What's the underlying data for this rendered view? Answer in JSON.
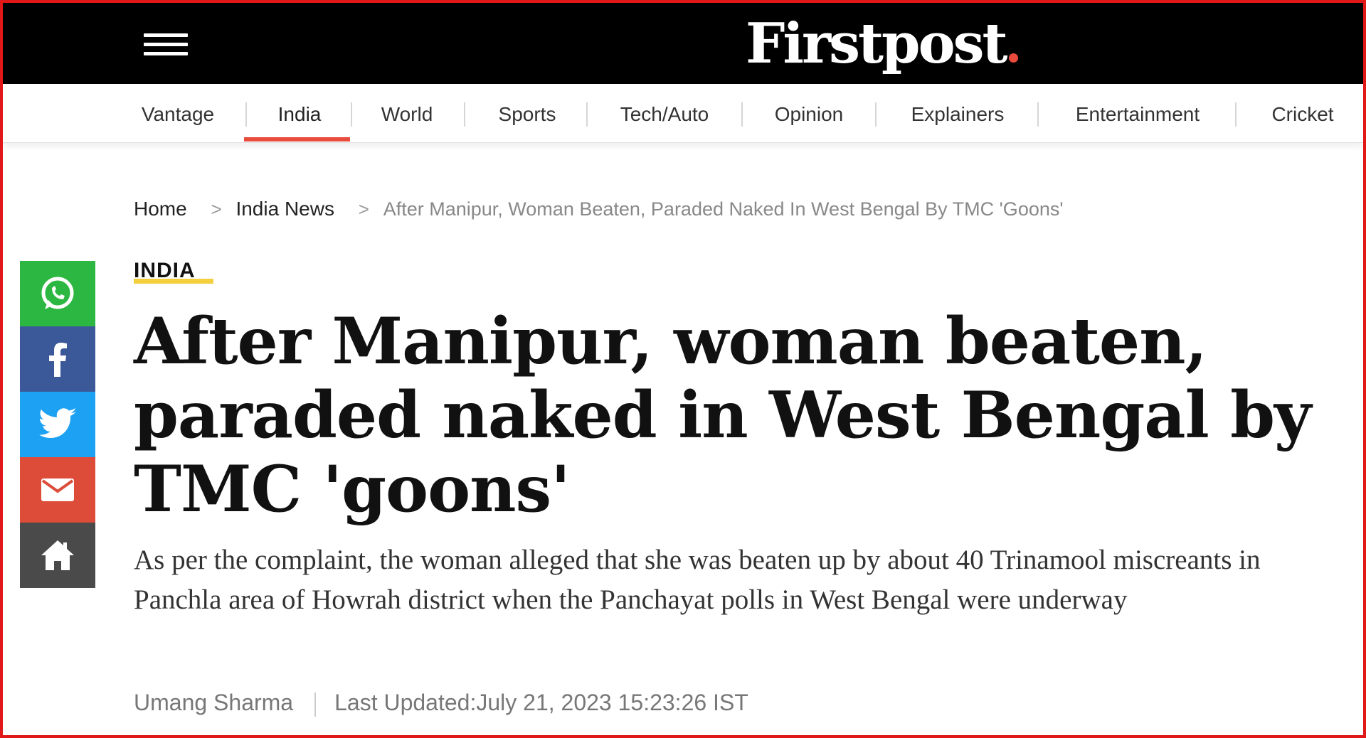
{
  "site": {
    "logo_text": "Firstpost",
    "logo_dot_color": "#ea4a3b"
  },
  "nav": {
    "items": [
      {
        "label": "Vantage"
      },
      {
        "label": "India"
      },
      {
        "label": "World"
      },
      {
        "label": "Sports"
      },
      {
        "label": "Tech/Auto"
      },
      {
        "label": "Opinion"
      },
      {
        "label": "Explainers"
      },
      {
        "label": "Entertainment"
      },
      {
        "label": "Cricket"
      }
    ],
    "active": "India",
    "active_color": "#e74c3c"
  },
  "breadcrumb": {
    "home": "Home",
    "section": "India News",
    "current": "After Manipur, Woman Beaten, Paraded Naked In West Bengal By TMC 'Goons'",
    "separator": ">"
  },
  "share": [
    {
      "icon": "whatsapp-icon",
      "color": "#2bb741"
    },
    {
      "icon": "facebook-icon",
      "color": "#3b5998"
    },
    {
      "icon": "twitter-icon",
      "color": "#1da1f2"
    },
    {
      "icon": "email-icon",
      "color": "#dd4b39"
    },
    {
      "icon": "home-icon",
      "color": "#4a4a4a"
    }
  ],
  "article": {
    "category": "INDIA",
    "category_accent": "#f4d03f",
    "headline": "After Manipur, woman beaten, paraded naked in West Bengal by TMC 'goons'",
    "summary": "As per the complaint, the woman alleged that she was beaten up by about 40 Trinamool miscreants in Panchla area of Howrah district when the Panchayat polls in West Bengal were underway",
    "author": "Umang Sharma",
    "updated": "Last Updated:July 21, 2023 15:23:26 IST"
  }
}
